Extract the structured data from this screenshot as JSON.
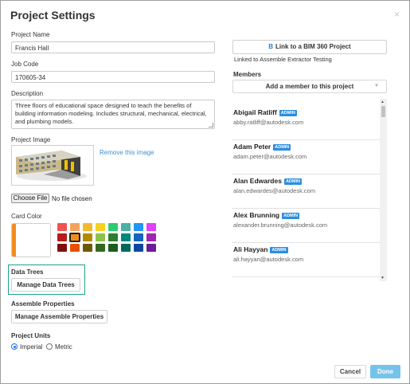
{
  "dialog": {
    "title": "Project Settings",
    "close_glyph": "×"
  },
  "project_name": {
    "label": "Project Name",
    "value": "Francis Hall"
  },
  "job_code": {
    "label": "Job Code",
    "value": "170605-34"
  },
  "description": {
    "label": "Description",
    "value": "Three floors of educational space designed to teach the benefits of building information modeling. Includes structural, mechanical, electrical, and plumbing models."
  },
  "project_image": {
    "label": "Project Image",
    "remove_link": "Remove this image",
    "choose_file": "Choose File",
    "no_file": "No file chosen"
  },
  "card_color": {
    "label": "Card Color",
    "selected": "#f28c1b",
    "swatches": [
      [
        "#ef5350",
        "#f4a460",
        "#f5b82e",
        "#f5d21f",
        "#2ecc71",
        "#4ab0a8",
        "#2196f3",
        "#e040fb"
      ],
      [
        "#b71c1c",
        "#f28c1b",
        "#b38b00",
        "#8bc34a",
        "#2e7d32",
        "#00897b",
        "#1565c0",
        "#9c27b0"
      ],
      [
        "#7f1010",
        "#e65100",
        "#6d5a00",
        "#33691e",
        "#1b5e20",
        "#00695c",
        "#0d47a1",
        "#6a1b9a"
      ]
    ]
  },
  "data_trees": {
    "label": "Data Trees",
    "button": "Manage Data Trees"
  },
  "assemble_properties": {
    "label": "Assemble Properties",
    "button": "Manage Assemble Properties"
  },
  "project_units": {
    "label": "Project Units",
    "options": [
      "Imperial",
      "Metric"
    ],
    "selected": "Imperial"
  },
  "bim360": {
    "icon": "B",
    "button": "Link to a BIM 360 Project",
    "linked_text": "Linked to Assemble Extractor Testing"
  },
  "members": {
    "label": "Members",
    "add_button": "Add a member to this project",
    "list": [
      {
        "name": "Abigail Ratliff",
        "badge": "ADMIN",
        "email": "abby.ratliff@autodesk.com"
      },
      {
        "name": "Adam Peter",
        "badge": "ADMIN",
        "email": "adam.peter@autodesk.com"
      },
      {
        "name": "Alan Edwardes",
        "badge": "ADMIN",
        "email": "alan.edwardes@autodesk.com"
      },
      {
        "name": "Alex Brunning",
        "badge": "ADMIN",
        "email": "alexander.brunning@autodesk.com"
      },
      {
        "name": "Ali Hayyan",
        "badge": "ADMIN",
        "email": "ali.hayyan@autodesk.com"
      }
    ]
  },
  "footer": {
    "cancel": "Cancel",
    "done": "Done"
  }
}
